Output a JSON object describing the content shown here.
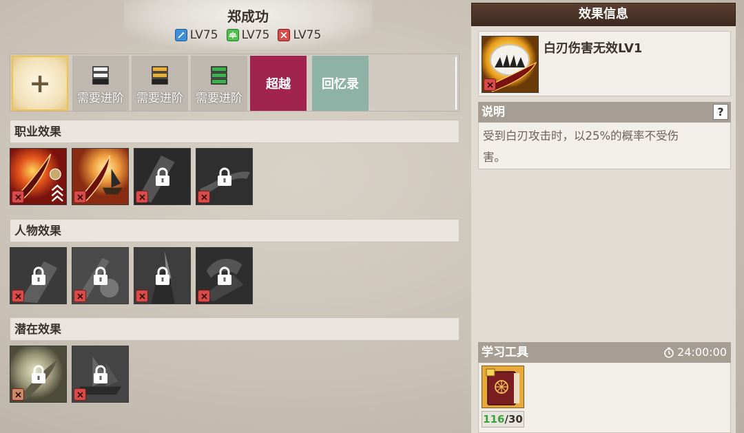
{
  "header": {
    "name": "郑成功",
    "levels": [
      {
        "label": "LV75",
        "color": "#3f8fd8",
        "icon": "sword-icon"
      },
      {
        "label": "LV75",
        "color": "#4fbf4f",
        "icon": "scale-icon"
      },
      {
        "label": "LV75",
        "color": "#d84b4b",
        "icon": "crossed-swords-icon"
      }
    ]
  },
  "top_buttons": {
    "add": "+",
    "need_1": "需要进阶",
    "need_2": "需要进阶",
    "need_3": "需要进阶",
    "transcend": "超越",
    "memoir": "回忆录"
  },
  "sections": {
    "job": "职业效果",
    "character": "人物效果",
    "latent": "潜在效果"
  },
  "effect_info": {
    "title": "效果信息",
    "name": "白刃伤害无效LV1",
    "desc_label": "说明",
    "help": "?",
    "description_line1": "受到白刃攻击时，以25%的概率不受伤",
    "description_line2": "害。"
  },
  "study_tool": {
    "label": "学习工具",
    "timer": "24:00:00",
    "have": "116",
    "sep": "/",
    "need": "30"
  },
  "colors": {
    "accent_transcend": "#a0244e",
    "accent_memoir": "#8fb2a6",
    "badge_red": "#d84b4b",
    "count_green": "#3ba23b"
  }
}
